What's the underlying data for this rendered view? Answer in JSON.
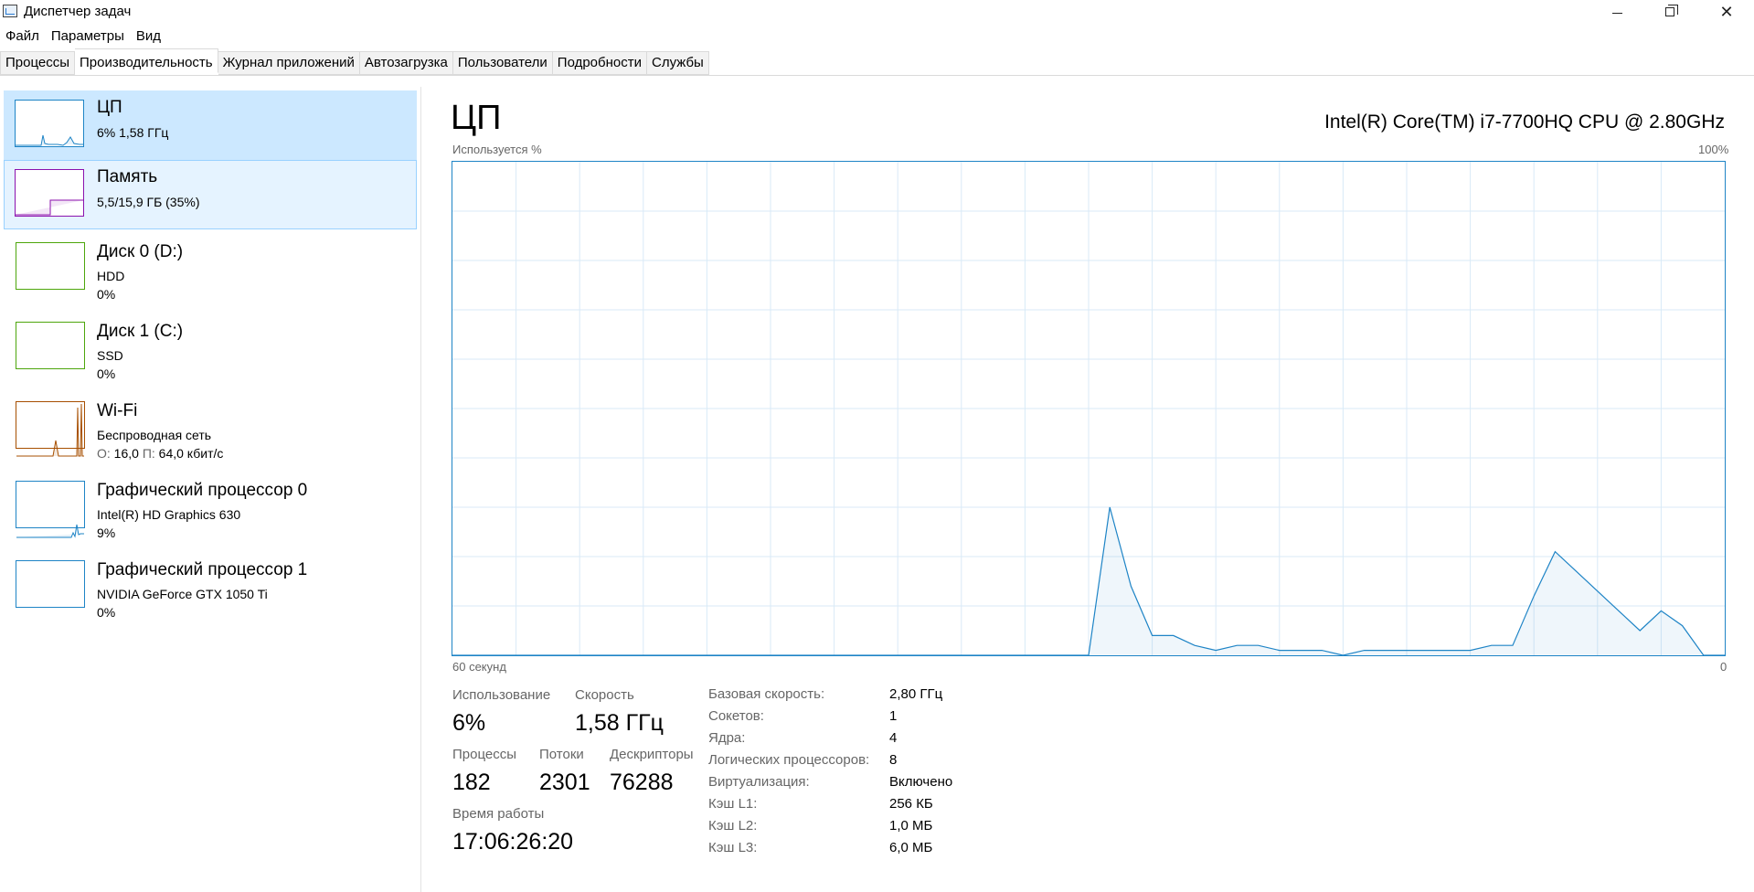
{
  "window": {
    "title": "Диспетчер задач",
    "controls": {
      "minimize": "minimize-icon",
      "maximize": "restore-icon",
      "close": "close-icon"
    }
  },
  "menu": [
    "Файл",
    "Параметры",
    "Вид"
  ],
  "tabs": [
    {
      "label": "Процессы",
      "active": false
    },
    {
      "label": "Производительность",
      "active": true
    },
    {
      "label": "Журнал приложений",
      "active": false
    },
    {
      "label": "Автозагрузка",
      "active": false
    },
    {
      "label": "Пользователи",
      "active": false
    },
    {
      "label": "Подробности",
      "active": false
    },
    {
      "label": "Службы",
      "active": false
    }
  ],
  "resources": [
    {
      "title": "ЦП",
      "line1": "6%  1,58 ГГц",
      "color": "#1e84c6"
    },
    {
      "title": "Память",
      "line1": "5,5/15,9 ГБ (35%)",
      "color": "#8b12ae"
    },
    {
      "title": "Диск 0 (D:)",
      "line1": "HDD",
      "line2": "0%",
      "color": "#4da60c"
    },
    {
      "title": "Диск 1 (C:)",
      "line1": "SSD",
      "line2": "0%",
      "color": "#4da60c"
    },
    {
      "title": "Wi-Fi",
      "line1": "Беспроводная сеть",
      "line2_send_label": "О:",
      "line2_send": " 16,0 ",
      "line2_recv_label": "П:",
      "line2_recv": " 64,0 кбит/с",
      "color": "#a74f01"
    },
    {
      "title": "Графический процессор 0",
      "line1": "Intel(R) HD Graphics 630",
      "line2": "9%",
      "color": "#1e84c6"
    },
    {
      "title": "Графический процессор 1",
      "line1": "NVIDIA GeForce GTX 1050 Ti",
      "line2": "0%",
      "color": "#1e84c6"
    }
  ],
  "main": {
    "title": "ЦП",
    "model": "Intel(R) Core(TM) i7-7700HQ CPU @ 2.80GHz",
    "graph_label_top_left": "Используется %",
    "graph_label_top_right": "100%",
    "graph_label_bottom_left": "60 секунд",
    "graph_label_bottom_right": "0"
  },
  "stats": {
    "usage_label": "Использование",
    "usage_value": "6%",
    "speed_label": "Скорость",
    "speed_value": "1,58 ГГц",
    "processes_label": "Процессы",
    "processes_value": "182",
    "threads_label": "Потоки",
    "threads_value": "2301",
    "handles_label": "Дескрипторы",
    "handles_value": "76288",
    "uptime_label": "Время работы",
    "uptime_value": "17:06:26:20"
  },
  "specs": [
    {
      "key": "Базовая скорость:",
      "value": "2,80 ГГц"
    },
    {
      "key": "Сокетов:",
      "value": "1"
    },
    {
      "key": "Ядра:",
      "value": "4"
    },
    {
      "key": "Логических процессоров:",
      "value": "8"
    },
    {
      "key": "Виртуализация:",
      "value": "Включено"
    },
    {
      "key": "Кэш L1:",
      "value": "256 КБ"
    },
    {
      "key": "Кэш L2:",
      "value": "1,0 МБ"
    },
    {
      "key": "Кэш L3:",
      "value": "6,0 МБ"
    }
  ],
  "chart_data": {
    "type": "area",
    "y_unit": "%",
    "ylim": [
      0,
      100
    ],
    "x_range_seconds": 60,
    "x_direction": "seconds ago, 60 on left to 0 on right",
    "grid": true,
    "color": "#1e84c6",
    "series": [
      {
        "x": [
          60,
          58,
          56,
          54,
          52,
          50,
          48,
          46,
          44,
          42,
          40,
          38,
          36,
          34,
          32,
          30,
          29,
          28,
          27,
          26,
          25,
          24,
          23,
          22,
          21,
          20,
          19,
          18,
          17,
          16,
          15,
          14,
          13,
          12,
          11,
          10,
          9,
          8,
          7,
          6,
          5,
          4,
          3,
          2,
          1,
          0
        ],
        "values": [
          0,
          0,
          0,
          0,
          0,
          0,
          0,
          0,
          0,
          0,
          0,
          0,
          0,
          0,
          0,
          0,
          30,
          14,
          4,
          4,
          2,
          1,
          2,
          2,
          1,
          1,
          1,
          0,
          1,
          1,
          1,
          1,
          1,
          1,
          2,
          2,
          12,
          21,
          17,
          13,
          9,
          5,
          9,
          6,
          0,
          0
        ]
      }
    ]
  }
}
